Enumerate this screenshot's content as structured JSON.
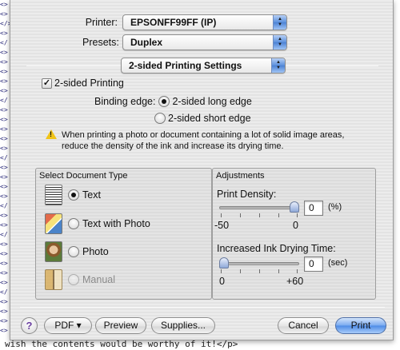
{
  "background": {
    "editor_lines": [
      "<>",
      "<>",
      "</>",
      "<>",
      "</",
      "<>",
      "<>",
      "<>",
      "<>",
      "<>",
      "</",
      "<>",
      "<>",
      "<>",
      "<>",
      "<>",
      "</",
      "<>",
      "<>",
      "<>",
      "<>",
      "</",
      "<>",
      "<>",
      "</",
      "<>",
      "<>",
      "<>",
      "<>",
      "<>",
      "</",
      "<>",
      "<>",
      "<>",
      "<>"
    ],
    "bottom_text": "wish the contents would be worthy of it!</p>"
  },
  "printer": {
    "label": "Printer:",
    "value": "EPSONFF99FF (IP)"
  },
  "presets": {
    "label": "Presets:",
    "value": "Duplex"
  },
  "panel": {
    "value": "2-sided Printing Settings"
  },
  "two_sided": {
    "label": "2-sided Printing",
    "checked": true
  },
  "binding": {
    "label": "Binding edge:",
    "options": [
      "2-sided long edge",
      "2-sided short edge"
    ],
    "selected": 0
  },
  "warning": {
    "line1": "When printing a photo or document containing a lot of solid image areas,",
    "line2": "reduce the density of the ink and increase its drying time."
  },
  "document_type": {
    "title": "Select Document Type",
    "options": [
      "Text",
      "Text with Photo",
      "Photo",
      "Manual"
    ],
    "selected": 0,
    "disabled": [
      3
    ]
  },
  "adjustments": {
    "title": "Adjustments",
    "density": {
      "label": "Print Density:",
      "value": "0",
      "unit": "(%)",
      "min": "-50",
      "max": "0",
      "level": 1.0
    },
    "drying": {
      "label": "Increased Ink Drying Time:",
      "value": "0",
      "unit": "(sec)",
      "min": "0",
      "max": "+60",
      "level": 0.0
    }
  },
  "buttons": {
    "help": "?",
    "pdf": "PDF ▾",
    "preview": "Preview",
    "supplies": "Supplies...",
    "cancel": "Cancel",
    "print": "Print"
  },
  "colors": {
    "accent": "#5a8fdc",
    "warning": "#f0c419"
  }
}
